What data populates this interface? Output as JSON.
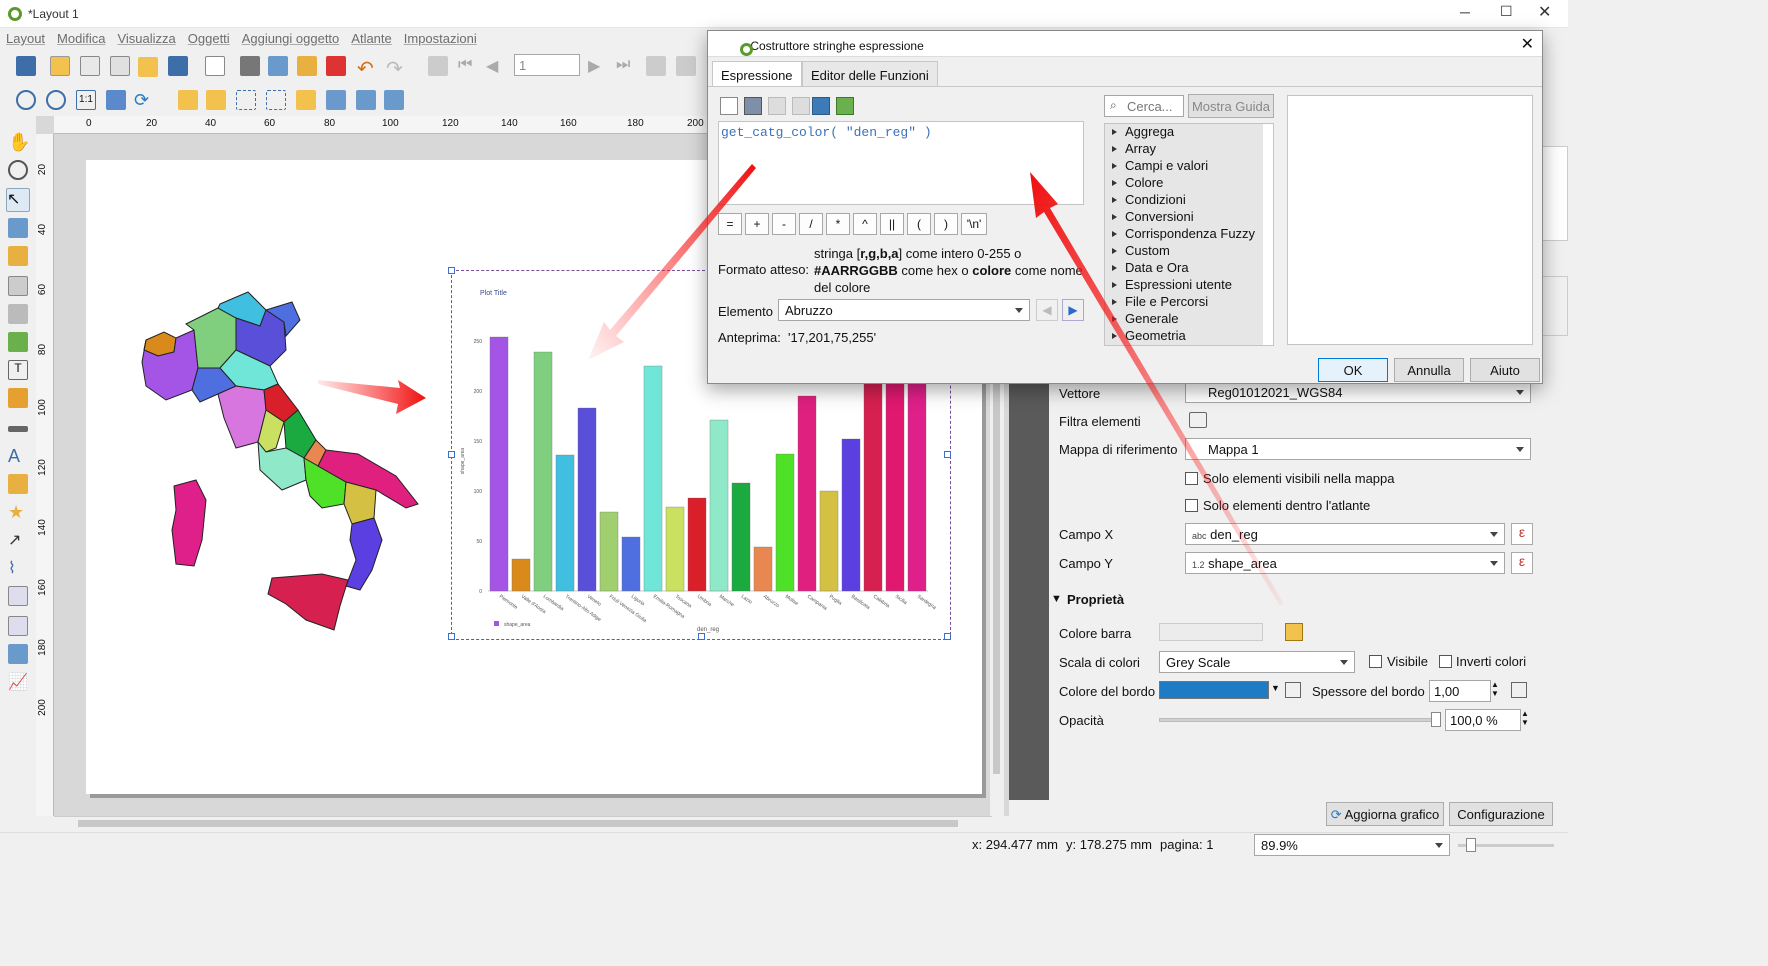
{
  "window": {
    "title": "*Layout 1"
  },
  "menu": [
    "Layout",
    "Modifica",
    "Visualizza",
    "Oggetti",
    "Aggiungi oggetto",
    "Atlante",
    "Impostazioni"
  ],
  "toolbar": {
    "page_input": "1"
  },
  "ruler": {
    "h_ticks": [
      "0",
      "20",
      "40",
      "60",
      "80",
      "100",
      "120",
      "140",
      "160",
      "180",
      "200"
    ],
    "v_ticks": [
      "20",
      "40",
      "60",
      "80",
      "100",
      "120",
      "140",
      "160",
      "180",
      "200"
    ]
  },
  "chart_data": {
    "type": "bar",
    "title": "Plot Title",
    "xlabel": "den_reg",
    "ylabel": "shape_area",
    "legend": "shape_area",
    "ylim": [
      0,
      260
    ],
    "yticks": [
      "0",
      "50",
      "100",
      "150",
      "200",
      "250"
    ],
    "categories": [
      "Piemonte",
      "Valle d'Aosta",
      "Lombardia",
      "Trentino-Alto Adige",
      "Veneto",
      "Friuli Venezia Giulia",
      "Liguria",
      "Emilia-Romagna",
      "Toscana",
      "Umbria",
      "Marche",
      "Lazio",
      "Abruzzo",
      "Molise",
      "Campania",
      "Puglia",
      "Basilicata",
      "Calabria",
      "Sicilia",
      "Sardegna"
    ],
    "values": [
      254,
      32,
      239,
      136,
      183,
      79,
      54,
      225,
      84,
      93,
      171,
      108,
      44,
      137,
      195,
      100,
      152,
      208,
      258,
      240
    ],
    "colors": [
      "#a455e6",
      "#d98a1a",
      "#7fcf7f",
      "#40bfe0",
      "#5a4fd8",
      "#9fcf6f",
      "#4f6fe0",
      "#6fe6d8",
      "#c9e060",
      "#d9202a",
      "#8fe8c8",
      "#1aaa40",
      "#e88850",
      "#4fe028",
      "#e0207f",
      "#d4c042",
      "#5b3fe0",
      "#d62050",
      "#e01870",
      "#e0208a"
    ]
  },
  "dialog": {
    "title": "Costruttore stringhe espressione",
    "tabs": [
      "Espressione",
      "Editor delle Funzioni"
    ],
    "expression": "get_catg_color(  \"den_reg\"  )",
    "operators": [
      "=",
      "+",
      "-",
      "/",
      "*",
      "^",
      "||",
      "(",
      ")",
      "'\\n'"
    ],
    "expected_label": "Formato atteso:",
    "expected_line1_pre": "stringa [",
    "expected_line1_bold": "r,g,b,a",
    "expected_line1_post": "] come intero 0-255 o",
    "expected_line2_bold": "#AARRGGBB",
    "expected_line2_mid": " come hex o ",
    "expected_line2_bold2": "colore",
    "expected_line2_post": " come nome",
    "expected_line3": "del colore",
    "element_label": "Elemento",
    "element_value": "Abruzzo",
    "preview_label": "Anteprima:",
    "preview_value": "'17,201,75,255'",
    "search_placeholder": "Cerca...",
    "show_help": "Mostra Guida",
    "functions": [
      "Aggrega",
      "Array",
      "Campi e valori",
      "Colore",
      "Condizioni",
      "Conversioni",
      "Corrispondenza Fuzzy",
      "Custom",
      "Data e Ora",
      "Espressioni utente",
      "File e Percorsi",
      "Generale",
      "Geometria"
    ],
    "ok": "OK",
    "cancel": "Annulla",
    "help": "Aiuto"
  },
  "panel": {
    "vettore_label": "Vettore",
    "vettore_value": "Reg01012021_WGS84",
    "filtra_label": "Filtra elementi",
    "mappa_label": "Mappa di riferimento",
    "mappa_value": "Mappa 1",
    "solo_visibili": "Solo elementi visibili nella mappa",
    "solo_atlante": "Solo elementi dentro l'atlante",
    "campo_x_label": "Campo X",
    "campo_x_type": "abc",
    "campo_x_value": "den_reg",
    "campo_y_label": "Campo Y",
    "campo_y_type": "1.2",
    "campo_y_value": "shape_area",
    "proprieta": "Proprietà",
    "colore_barra": "Colore barra",
    "scala_label": "Scala di colori",
    "scala_value": "Grey Scale",
    "visibile": "Visibile",
    "inverti": "Inverti colori",
    "bordo_label": "Colore del bordo",
    "bordo_color": "#1e7bc4",
    "spessore_label": "Spessore del bordo",
    "spessore_value": "1,00",
    "opacita_label": "Opacità",
    "opacita_value": "100,0 %",
    "aggiorna": "Aggiorna grafico",
    "configurazione": "Configurazione"
  },
  "status": {
    "x": "x: 294.477 mm",
    "y": "y: 178.275 mm",
    "page": "pagina: 1",
    "zoom": "89.9%"
  }
}
